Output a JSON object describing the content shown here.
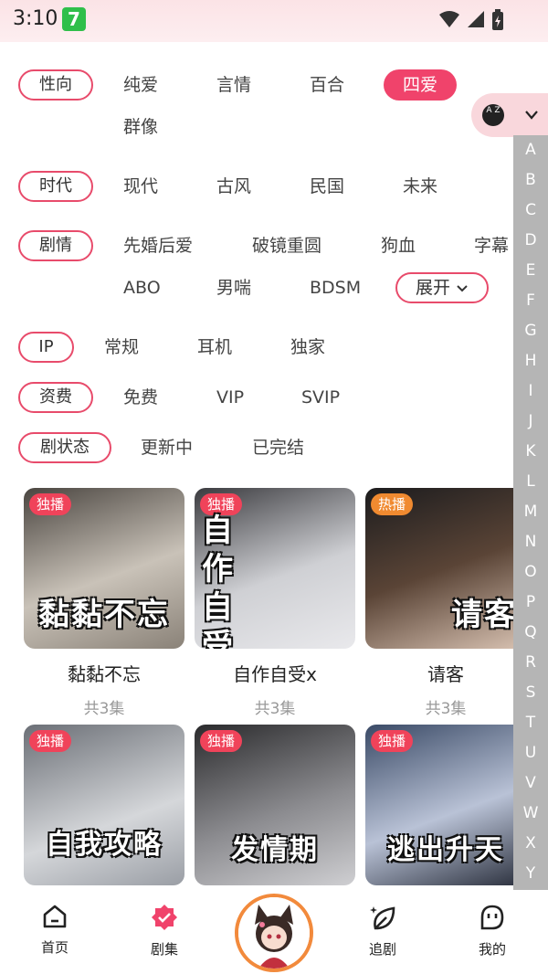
{
  "status_bar": {
    "time": "3:10",
    "app_badge": "7"
  },
  "filters": {
    "orientation": {
      "label": "性向",
      "options": [
        "纯爱",
        "言情",
        "百合",
        "四爱",
        "群像"
      ],
      "selected": "四爱"
    },
    "era": {
      "label": "时代",
      "options": [
        "现代",
        "古风",
        "民国",
        "未来"
      ]
    },
    "plot": {
      "label": "剧情",
      "options": [
        "先婚后爱",
        "破镜重圆",
        "狗血",
        "字幕",
        "ABO",
        "男喘",
        "BDSM"
      ],
      "expand_label": "展开"
    },
    "ip": {
      "label": "IP",
      "options": [
        "常规",
        "耳机",
        "独家"
      ]
    },
    "fee": {
      "label": "资费",
      "options": [
        "免费",
        "VIP",
        "SVIP"
      ]
    },
    "status": {
      "label": "剧状态",
      "options": [
        "更新中",
        "已完结"
      ]
    }
  },
  "sort_toggle": {
    "icon": "az-sort-icon",
    "az_text": "A Z"
  },
  "alphabet": [
    "A",
    "B",
    "C",
    "D",
    "E",
    "F",
    "G",
    "H",
    "I",
    "J",
    "K",
    "L",
    "M",
    "N",
    "O",
    "P",
    "Q",
    "R",
    "S",
    "T",
    "U",
    "V",
    "W",
    "X",
    "Y"
  ],
  "dramas": [
    {
      "badge": "独播",
      "badge_color": "#f0435a",
      "cover_text": "黏黏不忘",
      "title": "黏黏不忘",
      "episodes": "共3集"
    },
    {
      "badge": "独播",
      "badge_color": "#f0435a",
      "cover_text": "自作自受",
      "title": "自作自受x",
      "episodes": "共3集"
    },
    {
      "badge": "热播",
      "badge_color": "#f08a30",
      "cover_text": "请客",
      "title": "请客",
      "episodes": "共3集"
    },
    {
      "badge": "独播",
      "badge_color": "#f0435a",
      "cover_text": "自我攻略"
    },
    {
      "badge": "独播",
      "badge_color": "#f0435a",
      "cover_text": "发情期"
    },
    {
      "badge": "独播",
      "badge_color": "#f0435a",
      "cover_text": "逃出升天"
    }
  ],
  "bottom_nav": [
    {
      "label": "首页",
      "icon": "home-icon"
    },
    {
      "label": "剧集",
      "icon": "drama-badge-icon",
      "active": true
    },
    {
      "label": "",
      "icon": "avatar"
    },
    {
      "label": "追剧",
      "icon": "follow-leaf-icon"
    },
    {
      "label": "我的",
      "icon": "profile-icon"
    }
  ],
  "colors": {
    "accent": "#f0436b",
    "chip_border": "#e84b6b",
    "alpha_bar": "#b5b5b5"
  }
}
